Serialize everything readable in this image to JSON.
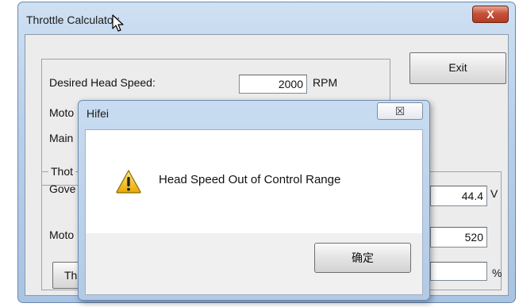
{
  "window": {
    "title": "Throttle Calculator:",
    "close_glyph": "X"
  },
  "main": {
    "exit_label": "Exit",
    "desired_head_speed_label": "Desired Head Speed:",
    "desired_head_speed_value": "2000",
    "rpm_unit": "RPM",
    "motor_label_partial": "Moto",
    "main_label_partial": "Main",
    "throttle_group_label_partial": "Thot",
    "governor_label_partial": "Gove",
    "motor2_label_partial": "Moto",
    "voltage_value": "44.4",
    "voltage_unit": "V",
    "motor_value": "520",
    "percent_unit": "%",
    "throttle_button_partial": "Th"
  },
  "dialog": {
    "title": "Hifei",
    "close_glyph": "☒",
    "message": "Head Speed Out of Control Range",
    "icon": "warning-icon",
    "ok_label": "确定"
  }
}
